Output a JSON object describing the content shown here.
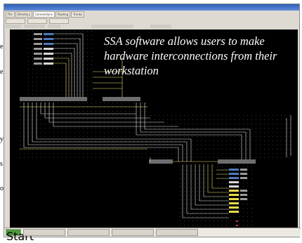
{
  "window": {
    "tabs": [
      "File",
      "Directory",
      "Connections",
      "Routing",
      "Trunks"
    ],
    "active_tab_index": 2,
    "status_items": [
      "Start",
      "",
      "",
      "",
      ""
    ]
  },
  "overlay": {
    "caption": "SSA software allows users to make hardware interconnections from their workstation"
  },
  "left_margin_fragments": [
    "e",
    "e",
    "y",
    "s",
    "o"
  ],
  "colors": {
    "canvas": "#000000",
    "line_yellow": "#f0e06a",
    "line_white": "#e8e8e8",
    "node_bar": "#6e6e6e",
    "accent_button": "#5a86c8"
  }
}
